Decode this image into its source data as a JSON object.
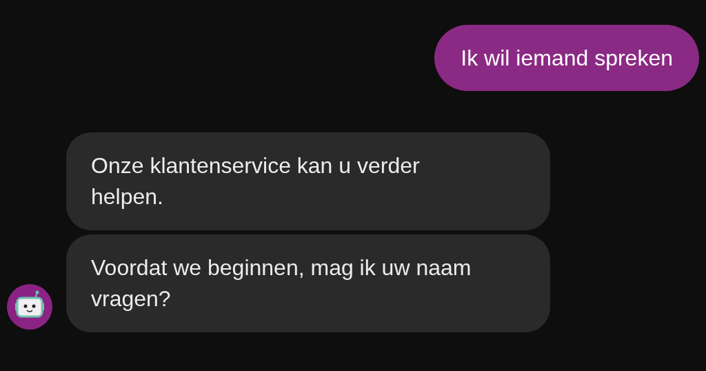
{
  "messages": [
    {
      "kind": "sent",
      "text": "Ik wil iemand spreken"
    },
    {
      "kind": "received",
      "text": "Onze klantenservice kan u verder helpen.",
      "avatar": false
    },
    {
      "kind": "received",
      "text": "Voordat we beginnen, mag ik uw naam vragen?",
      "avatar": true
    }
  ]
}
